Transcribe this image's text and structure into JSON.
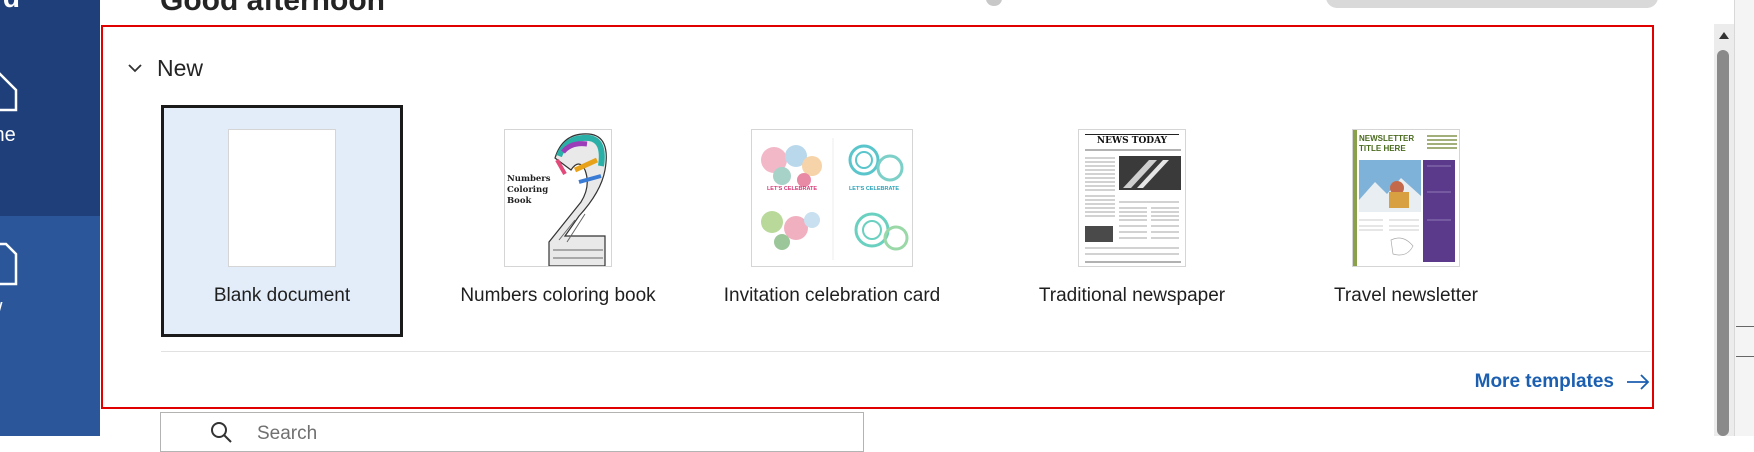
{
  "header": {
    "greeting": "Good afternoon"
  },
  "nav": {
    "logo_fragment": "rd",
    "items": [
      {
        "label": "me",
        "icon": "home-icon"
      },
      {
        "label": "w",
        "icon": "new-document-icon"
      }
    ]
  },
  "new_section": {
    "title": "New",
    "templates": [
      {
        "label": "Blank document",
        "selected": true
      },
      {
        "label": "Numbers coloring book",
        "selected": false
      },
      {
        "label": "Invitation celebration card",
        "selected": false
      },
      {
        "label": "Traditional newspaper",
        "selected": false
      },
      {
        "label": "Travel newsletter",
        "selected": false
      }
    ],
    "thumb_text": {
      "coloring_book": [
        "Numbers",
        "Coloring",
        "Book"
      ],
      "card_left": "LET'S CELEBRATE",
      "card_right": "LET'S CELEBRATE",
      "newspaper_title": "NEWS TODAY",
      "newsletter_title": [
        "NEWSLETTER",
        "TITLE HERE"
      ]
    },
    "more_templates": "More templates"
  },
  "search": {
    "placeholder": "Search"
  },
  "colors": {
    "rail_dark": "#1f3f7a",
    "rail": "#2b579a",
    "highlight_border": "#e00000",
    "accent_link": "#1c5fb1",
    "selected_tile_bg": "#e3ecf9"
  }
}
